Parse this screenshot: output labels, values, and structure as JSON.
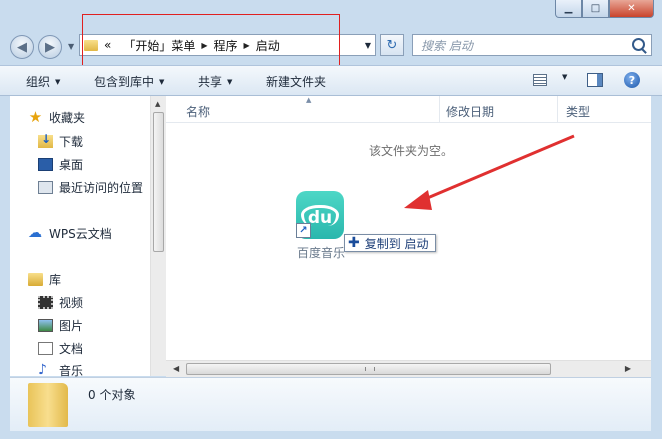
{
  "window": {
    "caption_buttons": [
      "minimize",
      "maximize",
      "close"
    ]
  },
  "addressbar": {
    "overflow": "«",
    "crumbs": [
      "「开始」菜单",
      "程序",
      "启动"
    ],
    "search_placeholder": "搜索 启动"
  },
  "toolbar": {
    "organize": "组织",
    "include_in_library": "包含到库中",
    "share": "共享",
    "new_folder": "新建文件夹"
  },
  "navpane": {
    "favorites": "收藏夹",
    "favorites_items": [
      "下载",
      "桌面",
      "最近访问的位置"
    ],
    "wps_cloud": "WPS云文档",
    "library": "库",
    "library_items": [
      "视频",
      "图片",
      "文档",
      "音乐"
    ]
  },
  "content": {
    "columns": [
      "名称",
      "修改日期",
      "类型"
    ],
    "empty_message": "该文件夹为空。",
    "dragged_item_label": "百度音乐",
    "drop_tooltip": "复制到 启动"
  },
  "details": {
    "item_count": "0 个对象"
  },
  "colors": {
    "frame": "#c9dcee",
    "highlight_box": "#e02020",
    "annotation_arrow": "#e03030",
    "app_icon": "#2ab7ad"
  }
}
